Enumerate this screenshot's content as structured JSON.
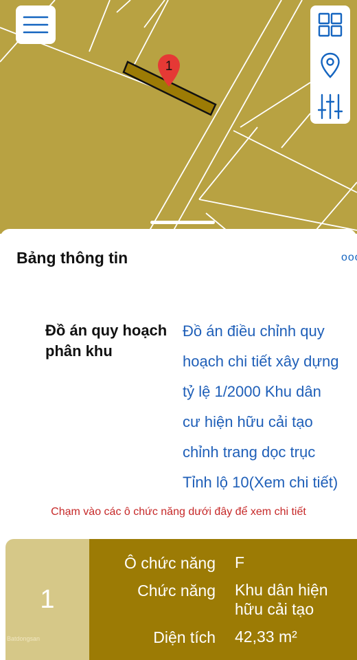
{
  "map": {
    "lot_marker": "1",
    "colors": {
      "land": "#b8a242",
      "lot": "#9c7b05",
      "marker": "#e53935"
    }
  },
  "toolbar": {
    "menu_icon": "hamburger-menu-icon",
    "grid_icon": "grid-icon",
    "location_icon": "location-pin-icon",
    "filter_icon": "sliders-icon"
  },
  "info_panel": {
    "title": "Bảng thông tin",
    "more_label": "ooo",
    "plan_label": "Đồ án quy hoạch phân khu",
    "plan_value": "Đồ án điều chỉnh quy\nhoạch chi tiết xây dựng\ntỷ lệ 1/2000  Khu dân\ncư hiện hữu cải tạo\nchỉnh trang dọc trục\nTỉnh lộ 10(Xem chi tiết)",
    "hint": "Chạm vào các ô chức năng dưới đây để xem chi tiết"
  },
  "lot_card": {
    "number": "1",
    "rows": [
      {
        "label": "Ô chức năng",
        "value": "F"
      },
      {
        "label": "Chức năng",
        "value": "Khu dân hiện hữu cải tạo"
      },
      {
        "label": "Diện tích",
        "value": "42,33 m²"
      }
    ],
    "watermark": "Batdongsan"
  }
}
